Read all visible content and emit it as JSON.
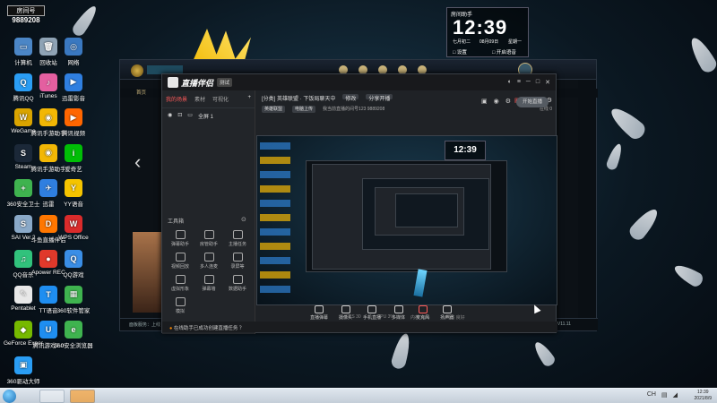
{
  "desktop": {
    "icons": [
      {
        "label": "计算机",
        "color": "#4b86c6",
        "glyph": "▭"
      },
      {
        "label": "回收站",
        "color": "#8fa3b5",
        "glyph": "🗑"
      },
      {
        "label": "网络",
        "color": "#3a78c0",
        "glyph": "◎"
      },
      {
        "label": "腾讯QQ",
        "color": "#2a9df4",
        "glyph": "Q"
      },
      {
        "label": "iTunes",
        "color": "#e45fa0",
        "glyph": "♪"
      },
      {
        "label": "迅雷影音",
        "color": "#2f7fe0",
        "glyph": "▶"
      },
      {
        "label": "WeGame",
        "color": "#d9a400",
        "glyph": "W"
      },
      {
        "label": "腾讯手游助手",
        "color": "#f2b705",
        "glyph": "◉"
      },
      {
        "label": "腾讯视频",
        "color": "#ff6600",
        "glyph": "▶"
      },
      {
        "label": "Steam",
        "color": "#1b2838",
        "glyph": "S"
      },
      {
        "label": "腾讯手游助手",
        "color": "#f2b705",
        "glyph": "◉"
      },
      {
        "label": "爱奇艺",
        "color": "#00be06",
        "glyph": "i"
      },
      {
        "label": "360安全卫士",
        "color": "#3fb34f",
        "glyph": "+"
      },
      {
        "label": "迅雷",
        "color": "#2f7fe0",
        "glyph": "✈"
      },
      {
        "label": "YY语音",
        "color": "#f5c400",
        "glyph": "Y"
      },
      {
        "label": "SAI Ver.2",
        "color": "#8aa9c8",
        "glyph": "S"
      },
      {
        "label": "斗鱼直播伴侣",
        "color": "#ff7700",
        "glyph": "D"
      },
      {
        "label": "WPS Office",
        "color": "#d92b2b",
        "glyph": "W"
      },
      {
        "label": "QQ音乐",
        "color": "#31c27c",
        "glyph": "♫"
      },
      {
        "label": "Apower REC",
        "color": "#e0392b",
        "glyph": "●"
      },
      {
        "label": "QQ游戏",
        "color": "#3a8ee6",
        "glyph": "Q"
      },
      {
        "label": "Pentablet",
        "color": "#e8e8e8",
        "glyph": "✎"
      },
      {
        "label": "TT语音",
        "color": "#1f8ef1",
        "glyph": "T"
      },
      {
        "label": "360软件管家",
        "color": "#3fb34f",
        "glyph": "▦"
      },
      {
        "label": "GeForce Experience",
        "color": "#76b900",
        "glyph": "◆"
      },
      {
        "label": "腾讯游戏7.0",
        "color": "#1f8ef1",
        "glyph": "U"
      },
      {
        "label": "360安全浏览器",
        "color": "#3fb34f",
        "glyph": "e"
      },
      {
        "label": "360驱动大师",
        "color": "#2a9df4",
        "glyph": "▣"
      }
    ],
    "room_label": "房间号",
    "room_number": "9889208"
  },
  "clock_widget": {
    "title": "房间助手",
    "time": "12:39",
    "date_left": "七月初二",
    "date_mid": "08月09日",
    "date_right": "星期一",
    "bottom_left": "□ 设置",
    "bottom_right": "□ 开启语音"
  },
  "game_client": {
    "nav_items": [
      "首页",
      "",
      "",
      ""
    ],
    "bottom_text": "面板服务：上线",
    "version": "V11.11"
  },
  "live_assistant": {
    "app_name": "直播伴侣",
    "badge": "测试",
    "left_tabs": [
      "我的场景",
      "素材",
      "可视化"
    ],
    "scene_name": "全屏 1",
    "tools_title": "工具箱",
    "tools": [
      "弹幕助手",
      "房管助手",
      "主播任务",
      "视频回放",
      "多人连麦",
      "录屏等",
      "虚拟形象",
      "弹幕墙",
      "数据助手",
      "模拟"
    ],
    "stream_title": "[分类] 英雄联盟 · 下饭局聊天中",
    "title_btn_1": "修改",
    "title_btn_2": "分享开播",
    "sub_game": "英雄联盟",
    "sub_btn": "电脑上传",
    "sub_room": "我当前直播的间号123  9889208",
    "sub_online": "在线 0",
    "bottom_tools": [
      "直播弹幕",
      "摄像头",
      "手机直播",
      "多媒体",
      "麦克风",
      "扬声器"
    ],
    "start_btn": "开始直播",
    "notice_prefix": "●",
    "notice_text": "在线助手已成功创建直播任务 ？",
    "status_items": [
      "FPS 30",
      "CPU 3%",
      "内存 39%",
      "网络 良好"
    ]
  },
  "preview": {
    "clock_text": "12:39"
  },
  "taskbar": {
    "tray_text": "CH",
    "time": "12:39",
    "date": "2021/8/9"
  },
  "colors": {
    "accent_red": "#ff5a5a",
    "warn_orange": "#ff8a00"
  }
}
